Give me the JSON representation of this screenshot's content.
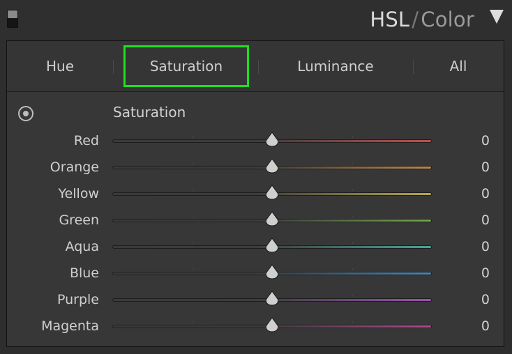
{
  "header": {
    "title_hsl": "HSL",
    "title_sep": "/",
    "title_color": "Color"
  },
  "tabs": [
    {
      "label": "Hue",
      "active": false
    },
    {
      "label": "Saturation",
      "active": true
    },
    {
      "label": "Luminance",
      "active": false
    },
    {
      "label": "All",
      "active": false
    }
  ],
  "section": {
    "title": "Saturation"
  },
  "sliders": [
    {
      "label": "Red",
      "value": "0",
      "color": "#c0504d"
    },
    {
      "label": "Orange",
      "value": "0",
      "color": "#b9874d"
    },
    {
      "label": "Yellow",
      "value": "0",
      "color": "#b8a84a"
    },
    {
      "label": "Green",
      "value": "0",
      "color": "#6fa54a"
    },
    {
      "label": "Aqua",
      "value": "0",
      "color": "#47a596"
    },
    {
      "label": "Blue",
      "value": "0",
      "color": "#4a86b0"
    },
    {
      "label": "Purple",
      "value": "0",
      "color": "#9a52b0"
    },
    {
      "label": "Magenta",
      "value": "0",
      "color": "#b04a8f"
    }
  ],
  "slider_range": [
    -100,
    100
  ],
  "colors": {
    "active_tab_outline": "#1fe01f",
    "panel_bg": "#373737",
    "header_bg": "#2f2f2f"
  }
}
